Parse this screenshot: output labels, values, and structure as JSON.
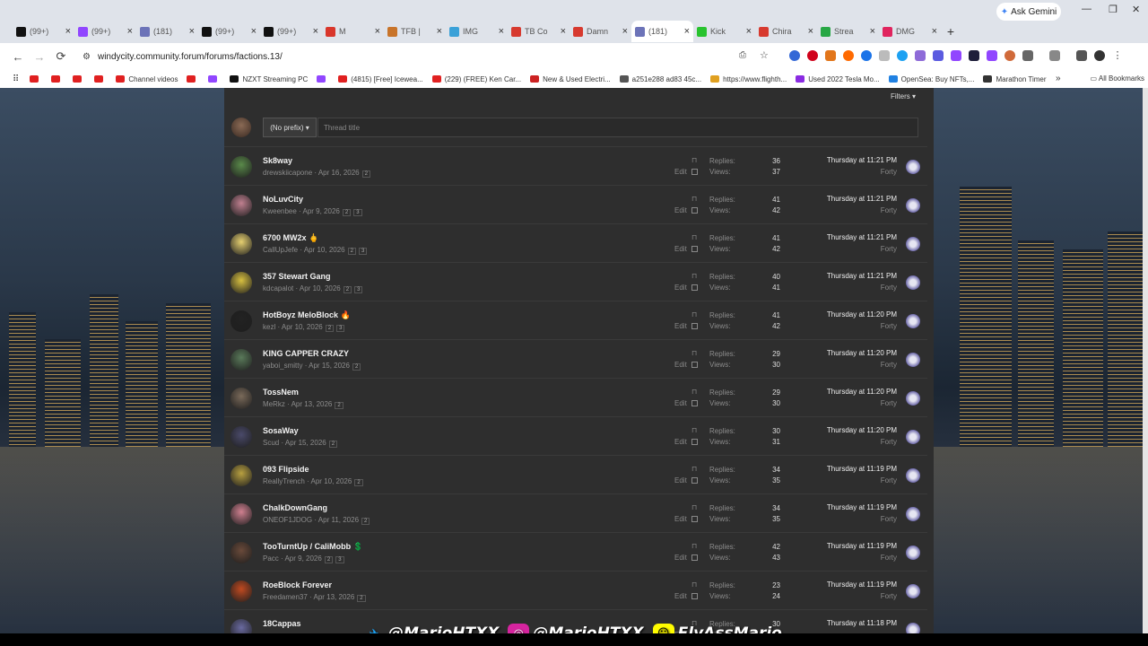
{
  "browser": {
    "tabs": [
      {
        "label": "(99+)",
        "color": "#111111"
      },
      {
        "label": "(99+)",
        "color": "#9146ff"
      },
      {
        "label": "(181)",
        "color": "#6c73b8"
      },
      {
        "label": "(99+)",
        "color": "#111111"
      },
      {
        "label": "(99+)",
        "color": "#111111"
      },
      {
        "label": "M",
        "color": "#d9362b"
      },
      {
        "label": "TFB |",
        "color": "#c8742a"
      },
      {
        "label": "IMG",
        "color": "#3aa1d8"
      },
      {
        "label": "TB Co",
        "color": "#d73a2f"
      },
      {
        "label": "Damn",
        "color": "#d73a2f"
      },
      {
        "label": "(181)",
        "color": "#6c73b8",
        "active": true
      },
      {
        "label": "Kick",
        "color": "#28c32e"
      },
      {
        "label": "Chira",
        "color": "#d73a2f"
      },
      {
        "label": "Strea",
        "color": "#28a745"
      },
      {
        "label": "DMG",
        "color": "#e0245e"
      }
    ],
    "ask_gemini": "Ask Gemini",
    "url": "windycity.community.forum/forums/factions.13/",
    "bookmarks": [
      {
        "label": "",
        "color": "#e02020"
      },
      {
        "label": "",
        "color": "#e02020"
      },
      {
        "label": "",
        "color": "#e02020"
      },
      {
        "label": "",
        "color": "#e02020"
      },
      {
        "label": "Channel videos",
        "color": "#e02020"
      },
      {
        "label": "",
        "color": "#e02020"
      },
      {
        "label": "",
        "color": "#9146ff"
      },
      {
        "label": "NZXT Streaming PC",
        "color": "#111111"
      },
      {
        "label": "",
        "color": "#9146ff"
      },
      {
        "label": "(4815) [Free] Icewea...",
        "color": "#e02020"
      },
      {
        "label": "(229) (FREE) Ken Car...",
        "color": "#e02020"
      },
      {
        "label": "New & Used Electri...",
        "color": "#cc2222"
      },
      {
        "label": "a251e288 ad83 45c...",
        "color": "#555555"
      },
      {
        "label": "https://www.flighth...",
        "color": "#e0a020"
      },
      {
        "label": "Used 2022 Tesla Mo...",
        "color": "#8a2be2"
      },
      {
        "label": "OpenSea: Buy NFTs,...",
        "color": "#2081e2"
      },
      {
        "label": "Marathon Timer",
        "color": "#333333"
      }
    ],
    "all_bookmarks": "All Bookmarks"
  },
  "forum": {
    "filters_label": "Filters ▾",
    "prefix_label": "(No prefix) ▾",
    "title_placeholder": "Thread title",
    "replies_label": "Replies:",
    "views_label": "Views:",
    "edit_label": "Edit",
    "last_user": "Forty",
    "threads": [
      {
        "title": "Sk8way",
        "author": "drewskiicapone",
        "date": "Apr 16, 2026",
        "pages": [
          "2"
        ],
        "replies": "36",
        "views": "37",
        "last": "Thursday at 11:21 PM",
        "avatar": "#5a8a4a"
      },
      {
        "title": "NoLuvCity",
        "author": "Kweenbee",
        "date": "Apr 9, 2026",
        "pages": [
          "2",
          "3"
        ],
        "replies": "41",
        "views": "42",
        "last": "Thursday at 11:21 PM",
        "avatar": "#c08090"
      },
      {
        "title": "6700 MW2x 🖕",
        "author": "CallUpJefe",
        "date": "Apr 10, 2026",
        "pages": [
          "2",
          "3"
        ],
        "replies": "41",
        "views": "42",
        "last": "Thursday at 11:21 PM",
        "avatar": "#e6d070"
      },
      {
        "title": "357 Stewart Gang",
        "author": "kdcapalot",
        "date": "Apr 10, 2026",
        "pages": [
          "2",
          "3"
        ],
        "replies": "40",
        "views": "41",
        "last": "Thursday at 11:21 PM",
        "avatar": "#d8c040"
      },
      {
        "title": "HotBoyz MeloBlock 🔥",
        "author": "kezl",
        "date": "Apr 10, 2026",
        "pages": [
          "2",
          "3"
        ],
        "replies": "41",
        "views": "42",
        "last": "Thursday at 11:20 PM",
        "avatar": "#222222"
      },
      {
        "title": "KING CAPPER CRAZY",
        "author": "yaboi_smitty",
        "date": "Apr 15, 2026",
        "pages": [
          "2"
        ],
        "replies": "29",
        "views": "30",
        "last": "Thursday at 11:20 PM",
        "avatar": "#5a7a5a"
      },
      {
        "title": "TossNem",
        "author": "MeRkz",
        "date": "Apr 13, 2026",
        "pages": [
          "2"
        ],
        "replies": "29",
        "views": "30",
        "last": "Thursday at 11:20 PM",
        "avatar": "#7a6a5a"
      },
      {
        "title": "SosaWay",
        "author": "Scud",
        "date": "Apr 15, 2026",
        "pages": [
          "2"
        ],
        "replies": "30",
        "views": "31",
        "last": "Thursday at 11:20 PM",
        "avatar": "#4a4a6a"
      },
      {
        "title": "093 Flipside",
        "author": "ReallyTrench",
        "date": "Apr 10, 2026",
        "pages": [
          "2"
        ],
        "replies": "34",
        "views": "35",
        "last": "Thursday at 11:19 PM",
        "avatar": "#b8a040"
      },
      {
        "title": "ChalkDownGang",
        "author": "ONEOF1JDOG",
        "date": "Apr 11, 2026",
        "pages": [
          "2"
        ],
        "replies": "34",
        "views": "35",
        "last": "Thursday at 11:19 PM",
        "avatar": "#d08090"
      },
      {
        "title": "TooTurntUp / CaliMobb 💲",
        "author": "Pacc",
        "date": "Apr 9, 2026",
        "pages": [
          "2",
          "3"
        ],
        "replies": "42",
        "views": "43",
        "last": "Thursday at 11:19 PM",
        "avatar": "#6a4a3a"
      },
      {
        "title": "RoeBlock Forever",
        "author": "Freedamen37",
        "date": "Apr 13, 2026",
        "pages": [
          "2"
        ],
        "replies": "23",
        "views": "24",
        "last": "Thursday at 11:19 PM",
        "avatar": "#c04a20"
      },
      {
        "title": "18Cappas",
        "author": "",
        "date": "",
        "pages": [],
        "replies": "30",
        "views": "",
        "last": "Thursday at 11:18 PM",
        "avatar": "#6a6aa0"
      }
    ]
  },
  "social": [
    {
      "handle": "@MarioHTXX",
      "icon": "twitter-icon",
      "color": "#1da1f2"
    },
    {
      "handle": "@MarioHTXX",
      "icon": "instagram-icon",
      "color": "#d6249f"
    },
    {
      "handle": "FlyAssMario",
      "icon": "snapchat-icon",
      "color": "#fffc00"
    }
  ]
}
